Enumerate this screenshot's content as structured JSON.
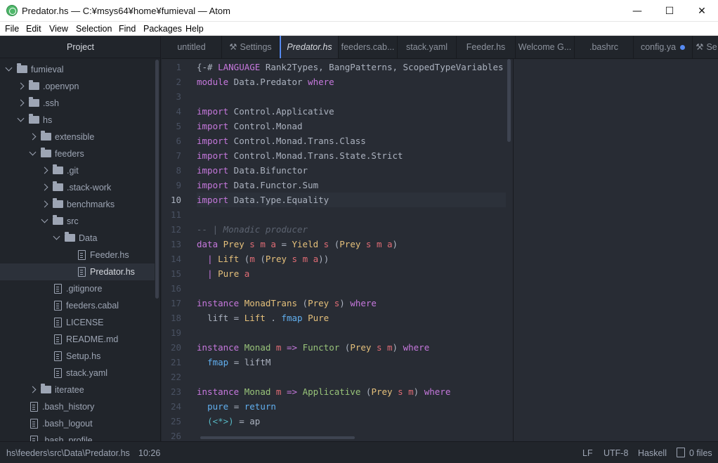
{
  "window": {
    "title": "Predator.hs — C:¥msys64¥home¥fumieval — Atom"
  },
  "menu": [
    "File",
    "Edit",
    "View",
    "Selection",
    "Find",
    "Packages",
    "Help"
  ],
  "tree": {
    "header": "Project",
    "rows": [
      {
        "label": "fumieval",
        "type": "folder",
        "expanded": true,
        "level": 0
      },
      {
        "label": ".openvpn",
        "type": "folder",
        "expanded": false,
        "level": 1
      },
      {
        "label": ".ssh",
        "type": "folder",
        "expanded": false,
        "level": 1
      },
      {
        "label": "hs",
        "type": "folder",
        "expanded": true,
        "level": 1
      },
      {
        "label": "extensible",
        "type": "folder",
        "expanded": false,
        "level": 2
      },
      {
        "label": "feeders",
        "type": "folder",
        "expanded": true,
        "level": 2
      },
      {
        "label": ".git",
        "type": "folder",
        "expanded": false,
        "level": 3
      },
      {
        "label": ".stack-work",
        "type": "folder",
        "expanded": false,
        "level": 3
      },
      {
        "label": "benchmarks",
        "type": "folder",
        "expanded": false,
        "level": 3
      },
      {
        "label": "src",
        "type": "folder",
        "expanded": true,
        "level": 3
      },
      {
        "label": "Data",
        "type": "folder",
        "expanded": true,
        "level": 4
      },
      {
        "label": "Feeder.hs",
        "type": "file",
        "level": 5
      },
      {
        "label": "Predator.hs",
        "type": "file",
        "level": 5,
        "selected": true
      },
      {
        "label": ".gitignore",
        "type": "file",
        "level": 3
      },
      {
        "label": "feeders.cabal",
        "type": "file",
        "level": 3
      },
      {
        "label": "LICENSE",
        "type": "file",
        "level": 3
      },
      {
        "label": "README.md",
        "type": "file",
        "level": 3
      },
      {
        "label": "Setup.hs",
        "type": "file",
        "level": 3
      },
      {
        "label": "stack.yaml",
        "type": "file",
        "level": 3
      },
      {
        "label": "iteratee",
        "type": "folder",
        "expanded": false,
        "level": 2
      },
      {
        "label": ".bash_history",
        "type": "file",
        "level": 1
      },
      {
        "label": ".bash_logout",
        "type": "file",
        "level": 1
      },
      {
        "label": ".bash_profile",
        "type": "file",
        "level": 1
      }
    ]
  },
  "tabs": [
    {
      "label": "untitled"
    },
    {
      "label": "Settings",
      "icon": "gear-icon"
    },
    {
      "label": "Predator.hs",
      "active": true
    },
    {
      "label": "feeders.cab..."
    },
    {
      "label": "stack.yaml"
    },
    {
      "label": "Feeder.hs"
    },
    {
      "label": "Welcome G..."
    },
    {
      "label": ".bashrc"
    },
    {
      "label": "config.ya",
      "modified": true
    },
    {
      "label": "Se",
      "icon": "gear-icon"
    }
  ],
  "editor": {
    "current_line": 10,
    "lines": [
      [
        [
          "",
          "{-# "
        ],
        [
          "kw",
          "LANGUAGE"
        ],
        [
          "",
          " Rank2Types, BangPatterns, ScopedTypeVariables"
        ]
      ],
      [
        [
          "kw",
          "module"
        ],
        [
          "",
          " Data.Predator "
        ],
        [
          "kw",
          "where"
        ]
      ],
      [],
      [
        [
          "kw",
          "import"
        ],
        [
          "",
          " Control.Applicative"
        ]
      ],
      [
        [
          "kw",
          "import"
        ],
        [
          "",
          " Control.Monad"
        ]
      ],
      [
        [
          "kw",
          "import"
        ],
        [
          "",
          " Control.Monad.Trans.Class"
        ]
      ],
      [
        [
          "kw",
          "import"
        ],
        [
          "",
          " Control.Monad.Trans.State.Strict"
        ]
      ],
      [
        [
          "kw",
          "import"
        ],
        [
          "",
          " Data.Bifunctor"
        ]
      ],
      [
        [
          "kw",
          "import"
        ],
        [
          "",
          " Data.Functor.Sum"
        ]
      ],
      [
        [
          "kw",
          "import"
        ],
        [
          "",
          " Data.Type.Equality"
        ]
      ],
      [],
      [
        [
          "cm",
          "-- | Monadic producer"
        ]
      ],
      [
        [
          "kw",
          "data"
        ],
        [
          "",
          " "
        ],
        [
          "ty",
          "Prey"
        ],
        [
          "",
          " "
        ],
        [
          "cn",
          "s m a"
        ],
        [
          "",
          " = "
        ],
        [
          "ty",
          "Yield"
        ],
        [
          "",
          " "
        ],
        [
          "cn",
          "s"
        ],
        [
          "",
          " ("
        ],
        [
          "ty",
          "Prey"
        ],
        [
          "",
          " "
        ],
        [
          "cn",
          "s m a"
        ],
        [
          "",
          ")"
        ]
      ],
      [
        [
          "",
          "  "
        ],
        [
          "kw",
          "|"
        ],
        [
          "",
          " "
        ],
        [
          "ty",
          "Lift"
        ],
        [
          "",
          " ("
        ],
        [
          "cn",
          "m"
        ],
        [
          "",
          " ("
        ],
        [
          "ty",
          "Prey"
        ],
        [
          "",
          " "
        ],
        [
          "cn",
          "s m a"
        ],
        [
          "",
          "))"
        ]
      ],
      [
        [
          "",
          "  "
        ],
        [
          "kw",
          "|"
        ],
        [
          "",
          " "
        ],
        [
          "ty",
          "Pure"
        ],
        [
          "",
          " "
        ],
        [
          "cn",
          "a"
        ]
      ],
      [],
      [
        [
          "kw",
          "instance"
        ],
        [
          "",
          " "
        ],
        [
          "ty",
          "MonadTrans"
        ],
        [
          "",
          " ("
        ],
        [
          "ty",
          "Prey"
        ],
        [
          "",
          " "
        ],
        [
          "cn",
          "s"
        ],
        [
          "",
          ") "
        ],
        [
          "kw",
          "where"
        ]
      ],
      [
        [
          "",
          "  lift = "
        ],
        [
          "ty",
          "Lift"
        ],
        [
          "",
          " . "
        ],
        [
          "fn",
          "fmap"
        ],
        [
          "",
          " "
        ],
        [
          "ty",
          "Pure"
        ]
      ],
      [],
      [
        [
          "kw",
          "instance"
        ],
        [
          "",
          " "
        ],
        [
          "cls",
          "Monad"
        ],
        [
          "",
          " "
        ],
        [
          "cn",
          "m"
        ],
        [
          "",
          " "
        ],
        [
          "kw",
          "=>"
        ],
        [
          "",
          " "
        ],
        [
          "cls",
          "Functor"
        ],
        [
          "",
          " ("
        ],
        [
          "ty",
          "Prey"
        ],
        [
          "",
          " "
        ],
        [
          "cn",
          "s m"
        ],
        [
          "",
          ") "
        ],
        [
          "kw",
          "where"
        ]
      ],
      [
        [
          "",
          "  "
        ],
        [
          "fn",
          "fmap"
        ],
        [
          "",
          " = liftM"
        ]
      ],
      [],
      [
        [
          "kw",
          "instance"
        ],
        [
          "",
          " "
        ],
        [
          "cls",
          "Monad"
        ],
        [
          "",
          " "
        ],
        [
          "cn",
          "m"
        ],
        [
          "",
          " "
        ],
        [
          "kw",
          "=>"
        ],
        [
          "",
          " "
        ],
        [
          "cls",
          "Applicative"
        ],
        [
          "",
          " ("
        ],
        [
          "ty",
          "Prey"
        ],
        [
          "",
          " "
        ],
        [
          "cn",
          "s m"
        ],
        [
          "",
          ") "
        ],
        [
          "kw",
          "where"
        ]
      ],
      [
        [
          "",
          "  "
        ],
        [
          "fn",
          "pure"
        ],
        [
          "",
          " = "
        ],
        [
          "fn",
          "return"
        ]
      ],
      [
        [
          "",
          "  "
        ],
        [
          "op",
          "(<*>)"
        ],
        [
          "",
          " = ap"
        ]
      ],
      []
    ]
  },
  "status": {
    "path": "hs\\feeders\\src\\Data\\Predator.hs",
    "cursor": "10:26",
    "line_ending": "LF",
    "encoding": "UTF-8",
    "grammar": "Haskell",
    "files": "0 files"
  }
}
